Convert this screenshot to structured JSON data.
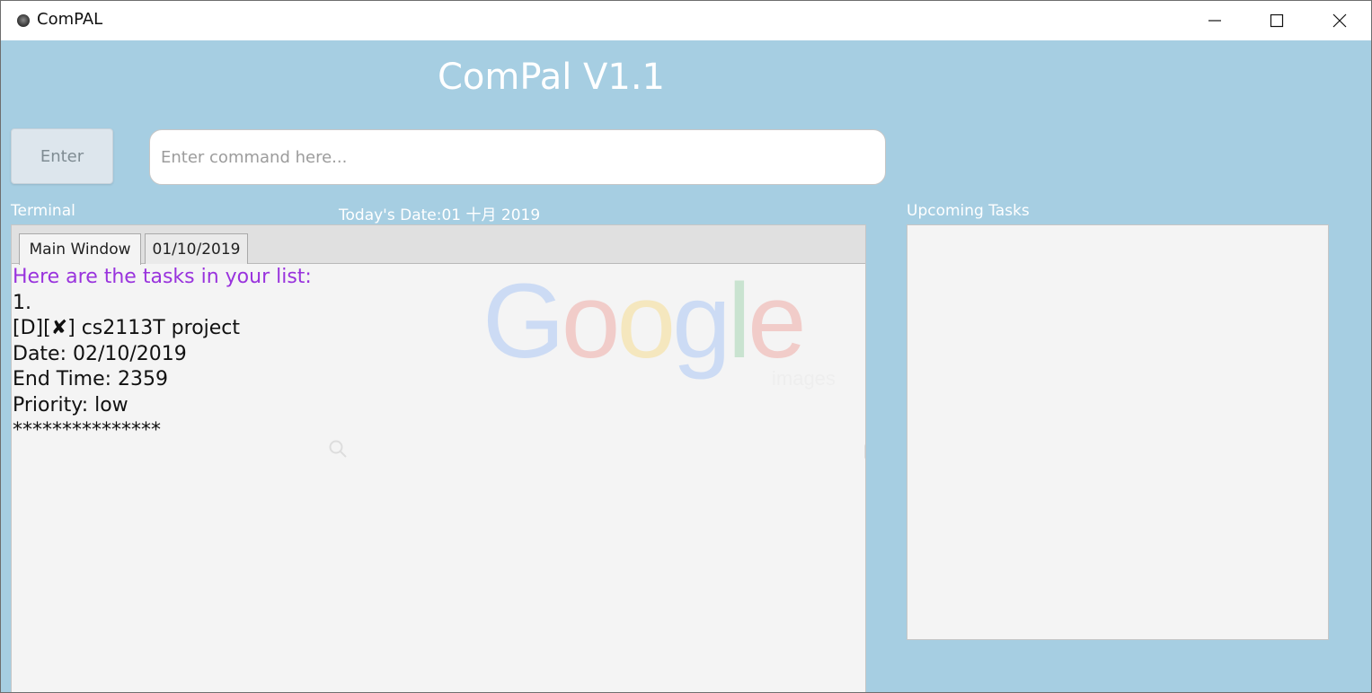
{
  "window": {
    "title": "ComPAL"
  },
  "header": {
    "app_title": "ComPal V1.1"
  },
  "command_bar": {
    "enter_label": "Enter",
    "input_placeholder": "Enter command here...",
    "input_value": ""
  },
  "labels": {
    "terminal": "Terminal",
    "todays_date": "Today's Date:01 十月 2019",
    "upcoming_tasks": "Upcoming Tasks"
  },
  "tabs": [
    {
      "label": "Main Window",
      "active": true
    },
    {
      "label": "01/10/2019",
      "active": false
    }
  ],
  "terminal_output": {
    "headline": "Here are the tasks in your list:",
    "lines": [
      "1.",
      "[D][✘] cs2113T project",
      "Date: 02/10/2019",
      "End Time: 2359",
      "Priority: low",
      "***************"
    ]
  },
  "watermark": {
    "letters": [
      "G",
      "o",
      "o",
      "g",
      "l",
      "e"
    ],
    "colors": [
      "#4285f4",
      "#ea4335",
      "#fbbc05",
      "#4285f4",
      "#34a853",
      "#ea4335"
    ],
    "sub": "images"
  },
  "icons": {
    "app": "compal-app-icon",
    "minimize": "minimize-icon",
    "maximize": "maximize-icon",
    "close": "close-icon",
    "watermark_search": "search-icon",
    "watermark_camera": "camera-icon",
    "watermark_mic": "microphone-icon"
  },
  "upcoming_tasks": []
}
